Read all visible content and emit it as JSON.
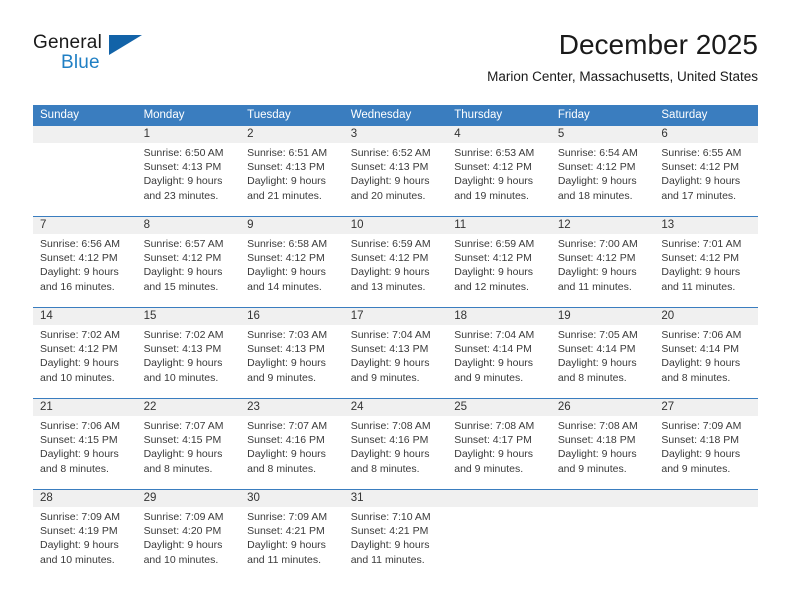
{
  "brand": {
    "word_one": "General",
    "word_two": "Blue",
    "logo_icon": "triangle-logo-icon"
  },
  "header": {
    "title": "December 2025",
    "subtitle": "Marion Center, Massachusetts, United States"
  },
  "colors": {
    "header_blue": "#3a7dbf",
    "brand_blue": "#1f7fc4",
    "logo_blue": "#1263a8",
    "daynum_bg": "#f0f0f0",
    "text": "#222222"
  },
  "weekday_headers": [
    "Sunday",
    "Monday",
    "Tuesday",
    "Wednesday",
    "Thursday",
    "Friday",
    "Saturday"
  ],
  "weeks": [
    [
      {
        "day": "",
        "sunrise": "",
        "sunset": "",
        "daylight_line1": "",
        "daylight_line2": ""
      },
      {
        "day": "1",
        "sunrise": "Sunrise: 6:50 AM",
        "sunset": "Sunset: 4:13 PM",
        "daylight_line1": "Daylight: 9 hours",
        "daylight_line2": "and 23 minutes."
      },
      {
        "day": "2",
        "sunrise": "Sunrise: 6:51 AM",
        "sunset": "Sunset: 4:13 PM",
        "daylight_line1": "Daylight: 9 hours",
        "daylight_line2": "and 21 minutes."
      },
      {
        "day": "3",
        "sunrise": "Sunrise: 6:52 AM",
        "sunset": "Sunset: 4:13 PM",
        "daylight_line1": "Daylight: 9 hours",
        "daylight_line2": "and 20 minutes."
      },
      {
        "day": "4",
        "sunrise": "Sunrise: 6:53 AM",
        "sunset": "Sunset: 4:12 PM",
        "daylight_line1": "Daylight: 9 hours",
        "daylight_line2": "and 19 minutes."
      },
      {
        "day": "5",
        "sunrise": "Sunrise: 6:54 AM",
        "sunset": "Sunset: 4:12 PM",
        "daylight_line1": "Daylight: 9 hours",
        "daylight_line2": "and 18 minutes."
      },
      {
        "day": "6",
        "sunrise": "Sunrise: 6:55 AM",
        "sunset": "Sunset: 4:12 PM",
        "daylight_line1": "Daylight: 9 hours",
        "daylight_line2": "and 17 minutes."
      }
    ],
    [
      {
        "day": "7",
        "sunrise": "Sunrise: 6:56 AM",
        "sunset": "Sunset: 4:12 PM",
        "daylight_line1": "Daylight: 9 hours",
        "daylight_line2": "and 16 minutes."
      },
      {
        "day": "8",
        "sunrise": "Sunrise: 6:57 AM",
        "sunset": "Sunset: 4:12 PM",
        "daylight_line1": "Daylight: 9 hours",
        "daylight_line2": "and 15 minutes."
      },
      {
        "day": "9",
        "sunrise": "Sunrise: 6:58 AM",
        "sunset": "Sunset: 4:12 PM",
        "daylight_line1": "Daylight: 9 hours",
        "daylight_line2": "and 14 minutes."
      },
      {
        "day": "10",
        "sunrise": "Sunrise: 6:59 AM",
        "sunset": "Sunset: 4:12 PM",
        "daylight_line1": "Daylight: 9 hours",
        "daylight_line2": "and 13 minutes."
      },
      {
        "day": "11",
        "sunrise": "Sunrise: 6:59 AM",
        "sunset": "Sunset: 4:12 PM",
        "daylight_line1": "Daylight: 9 hours",
        "daylight_line2": "and 12 minutes."
      },
      {
        "day": "12",
        "sunrise": "Sunrise: 7:00 AM",
        "sunset": "Sunset: 4:12 PM",
        "daylight_line1": "Daylight: 9 hours",
        "daylight_line2": "and 11 minutes."
      },
      {
        "day": "13",
        "sunrise": "Sunrise: 7:01 AM",
        "sunset": "Sunset: 4:12 PM",
        "daylight_line1": "Daylight: 9 hours",
        "daylight_line2": "and 11 minutes."
      }
    ],
    [
      {
        "day": "14",
        "sunrise": "Sunrise: 7:02 AM",
        "sunset": "Sunset: 4:12 PM",
        "daylight_line1": "Daylight: 9 hours",
        "daylight_line2": "and 10 minutes."
      },
      {
        "day": "15",
        "sunrise": "Sunrise: 7:02 AM",
        "sunset": "Sunset: 4:13 PM",
        "daylight_line1": "Daylight: 9 hours",
        "daylight_line2": "and 10 minutes."
      },
      {
        "day": "16",
        "sunrise": "Sunrise: 7:03 AM",
        "sunset": "Sunset: 4:13 PM",
        "daylight_line1": "Daylight: 9 hours",
        "daylight_line2": "and 9 minutes."
      },
      {
        "day": "17",
        "sunrise": "Sunrise: 7:04 AM",
        "sunset": "Sunset: 4:13 PM",
        "daylight_line1": "Daylight: 9 hours",
        "daylight_line2": "and 9 minutes."
      },
      {
        "day": "18",
        "sunrise": "Sunrise: 7:04 AM",
        "sunset": "Sunset: 4:14 PM",
        "daylight_line1": "Daylight: 9 hours",
        "daylight_line2": "and 9 minutes."
      },
      {
        "day": "19",
        "sunrise": "Sunrise: 7:05 AM",
        "sunset": "Sunset: 4:14 PM",
        "daylight_line1": "Daylight: 9 hours",
        "daylight_line2": "and 8 minutes."
      },
      {
        "day": "20",
        "sunrise": "Sunrise: 7:06 AM",
        "sunset": "Sunset: 4:14 PM",
        "daylight_line1": "Daylight: 9 hours",
        "daylight_line2": "and 8 minutes."
      }
    ],
    [
      {
        "day": "21",
        "sunrise": "Sunrise: 7:06 AM",
        "sunset": "Sunset: 4:15 PM",
        "daylight_line1": "Daylight: 9 hours",
        "daylight_line2": "and 8 minutes."
      },
      {
        "day": "22",
        "sunrise": "Sunrise: 7:07 AM",
        "sunset": "Sunset: 4:15 PM",
        "daylight_line1": "Daylight: 9 hours",
        "daylight_line2": "and 8 minutes."
      },
      {
        "day": "23",
        "sunrise": "Sunrise: 7:07 AM",
        "sunset": "Sunset: 4:16 PM",
        "daylight_line1": "Daylight: 9 hours",
        "daylight_line2": "and 8 minutes."
      },
      {
        "day": "24",
        "sunrise": "Sunrise: 7:08 AM",
        "sunset": "Sunset: 4:16 PM",
        "daylight_line1": "Daylight: 9 hours",
        "daylight_line2": "and 8 minutes."
      },
      {
        "day": "25",
        "sunrise": "Sunrise: 7:08 AM",
        "sunset": "Sunset: 4:17 PM",
        "daylight_line1": "Daylight: 9 hours",
        "daylight_line2": "and 9 minutes."
      },
      {
        "day": "26",
        "sunrise": "Sunrise: 7:08 AM",
        "sunset": "Sunset: 4:18 PM",
        "daylight_line1": "Daylight: 9 hours",
        "daylight_line2": "and 9 minutes."
      },
      {
        "day": "27",
        "sunrise": "Sunrise: 7:09 AM",
        "sunset": "Sunset: 4:18 PM",
        "daylight_line1": "Daylight: 9 hours",
        "daylight_line2": "and 9 minutes."
      }
    ],
    [
      {
        "day": "28",
        "sunrise": "Sunrise: 7:09 AM",
        "sunset": "Sunset: 4:19 PM",
        "daylight_line1": "Daylight: 9 hours",
        "daylight_line2": "and 10 minutes."
      },
      {
        "day": "29",
        "sunrise": "Sunrise: 7:09 AM",
        "sunset": "Sunset: 4:20 PM",
        "daylight_line1": "Daylight: 9 hours",
        "daylight_line2": "and 10 minutes."
      },
      {
        "day": "30",
        "sunrise": "Sunrise: 7:09 AM",
        "sunset": "Sunset: 4:21 PM",
        "daylight_line1": "Daylight: 9 hours",
        "daylight_line2": "and 11 minutes."
      },
      {
        "day": "31",
        "sunrise": "Sunrise: 7:10 AM",
        "sunset": "Sunset: 4:21 PM",
        "daylight_line1": "Daylight: 9 hours",
        "daylight_line2": "and 11 minutes."
      },
      {
        "day": "",
        "sunrise": "",
        "sunset": "",
        "daylight_line1": "",
        "daylight_line2": ""
      },
      {
        "day": "",
        "sunrise": "",
        "sunset": "",
        "daylight_line1": "",
        "daylight_line2": ""
      },
      {
        "day": "",
        "sunrise": "",
        "sunset": "",
        "daylight_line1": "",
        "daylight_line2": ""
      }
    ]
  ]
}
